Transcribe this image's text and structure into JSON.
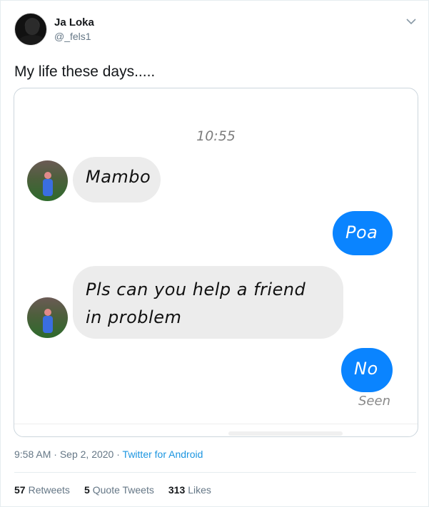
{
  "author": {
    "name": "Ja Loka",
    "handle": "@_fels1",
    "avatar_icon": "profile-photo"
  },
  "tweet": {
    "text": "My life these days.....",
    "menu_icon": "chevron-down-icon"
  },
  "chat": {
    "time": "10:55",
    "messages": [
      {
        "side": "in",
        "text": "Mambo"
      },
      {
        "side": "out",
        "text": "Poa"
      },
      {
        "side": "in",
        "line1": "Pls can you help a friend",
        "line2": "in problem"
      },
      {
        "side": "out",
        "text": "No"
      }
    ],
    "status": "Seen",
    "colors": {
      "outgoing": "#0a84ff",
      "incoming": "#ececec"
    }
  },
  "meta": {
    "time": "9:58 AM",
    "separator1": " · ",
    "date": "Sep 2, 2020",
    "separator2": " · ",
    "source": "Twitter for Android"
  },
  "stats": {
    "retweets_count": "57",
    "retweets_label": "Retweets",
    "quotes_count": "5",
    "quotes_label": "Quote Tweets",
    "likes_count": "313",
    "likes_label": "Likes"
  },
  "colors": {
    "link": "#1b95e0",
    "secondary_text": "#657786"
  }
}
